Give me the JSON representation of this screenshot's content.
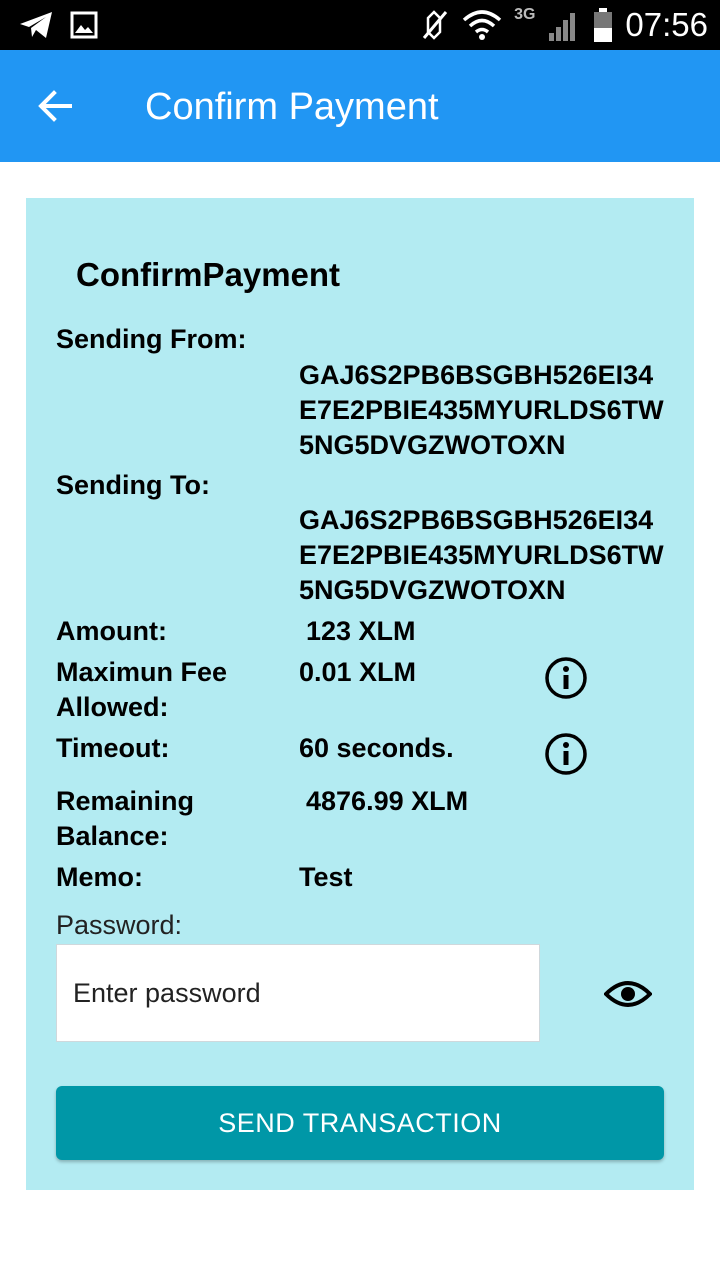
{
  "status_bar": {
    "time": "07:56",
    "network": "3G",
    "icons": [
      "telegram-icon",
      "image-icon",
      "mute-icon",
      "wifi-icon",
      "signal-icon",
      "battery-icon"
    ]
  },
  "app_bar": {
    "title": "Confirm Payment",
    "back_icon": "arrow-back-icon",
    "color": "#2196f3"
  },
  "card": {
    "background": "#b3ebf2",
    "title": "ConfirmPayment",
    "sending_from_label": "Sending From:",
    "sending_from_value": "GAJ6S2PB6BSGBH526EI34E7E2PBIE435MYURLDS6TW5NG5DVGZWOTOXN",
    "sending_to_label": "Sending To:",
    "sending_to_value": "GAJ6S2PB6BSGBH526EI34E7E2PBIE435MYURLDS6TW5NG5DVGZWOTOXN",
    "amount_label": "Amount:",
    "amount_value": "123 XLM",
    "fee_label": "Maximun Fee Allowed:",
    "fee_value": "0.01 XLM",
    "timeout_label": "Timeout:",
    "timeout_value": "60 seconds.",
    "balance_label": "Remaining Balance:",
    "balance_value": "4876.99 XLM",
    "memo_label": "Memo:",
    "memo_value": "Test"
  },
  "password": {
    "label": "Password:",
    "placeholder": "Enter password",
    "value": ""
  },
  "send_button": {
    "label": "SEND TRANSACTION",
    "color": "#0097a7"
  }
}
